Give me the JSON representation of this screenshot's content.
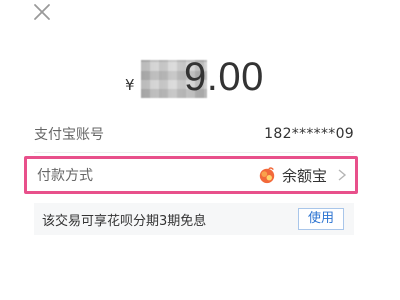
{
  "header": {
    "close_icon": "close-icon"
  },
  "amount": {
    "currency_symbol": "¥",
    "value_visible": "9.00",
    "obscured": true
  },
  "account": {
    "label": "支付宝账号",
    "value": "182******09"
  },
  "payment_method": {
    "label": "付款方式",
    "selected": "余额宝",
    "icon": "yuebao-icon",
    "chevron_icon": "chevron-right-icon",
    "highlight_color": "#e8508b"
  },
  "promo": {
    "text": "该交易可享花呗分期3期免息",
    "button_label": "使用",
    "button_color": "#2b73d1"
  }
}
